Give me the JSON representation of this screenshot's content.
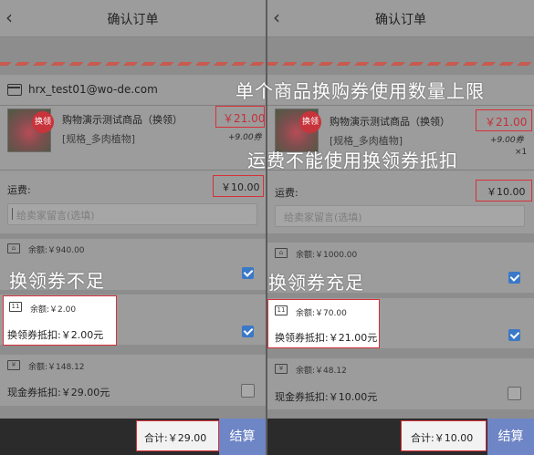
{
  "left": {
    "header": {
      "title": "确认订单",
      "back_icon": "‹"
    },
    "store": {
      "name": "hrx_test01@wo-de.com"
    },
    "product": {
      "name": "购物演示测试商品（换领）",
      "spec": "[规格_多肉植物]",
      "price": "￥21.00",
      "coupon": "+9.00券",
      "badge": "换领"
    },
    "shipping": {
      "label": "运费:",
      "value": "￥10.00"
    },
    "message": {
      "placeholder": "给卖家留言(选填)"
    },
    "wallet1": {
      "balance": "余额:￥940.00",
      "deduct": ""
    },
    "voucher": {
      "icon": "11",
      "balance": "余额:￥2.00",
      "deduct": "换领券抵扣:￥2.00元"
    },
    "cash": {
      "icon": "¥",
      "balance": "余额:￥148.12",
      "deduct": "现金券抵扣:￥29.00元"
    },
    "footer": {
      "total": "合计:￥29.00",
      "pay": "结算"
    },
    "overlay": "换领券不足"
  },
  "right": {
    "header": {
      "title": "确认订单",
      "back_icon": "‹"
    },
    "store": {
      "name": ""
    },
    "product": {
      "name": "购物演示测试商品（换领）",
      "spec": "[规格_多肉植物]",
      "price": "￥21.00",
      "coupon": "+9.00券",
      "qty": "×1"
    },
    "shipping": {
      "label": "运费:",
      "value": "￥10.00"
    },
    "message": {
      "placeholder": "给卖家留言(选填)"
    },
    "wallet1": {
      "balance": "余额:￥1000.00"
    },
    "voucher": {
      "icon": "11",
      "balance": "余额:￥70.00",
      "deduct": "换领券抵扣:￥21.00元"
    },
    "cash": {
      "icon": "¥",
      "balance": "余额:￥48.12",
      "deduct": "现金券抵扣:￥10.00元"
    },
    "footer": {
      "total": "合计:￥10.00",
      "pay": "结算"
    },
    "overlay_top": "单个商品换购券使用数量上限",
    "overlay_mid": "运费不能使用换领券抵扣",
    "overlay": "换领券充足"
  },
  "colors": {
    "highlight": "#d6313a",
    "accent": "#3a78c8",
    "pay": "#6e86c6"
  }
}
